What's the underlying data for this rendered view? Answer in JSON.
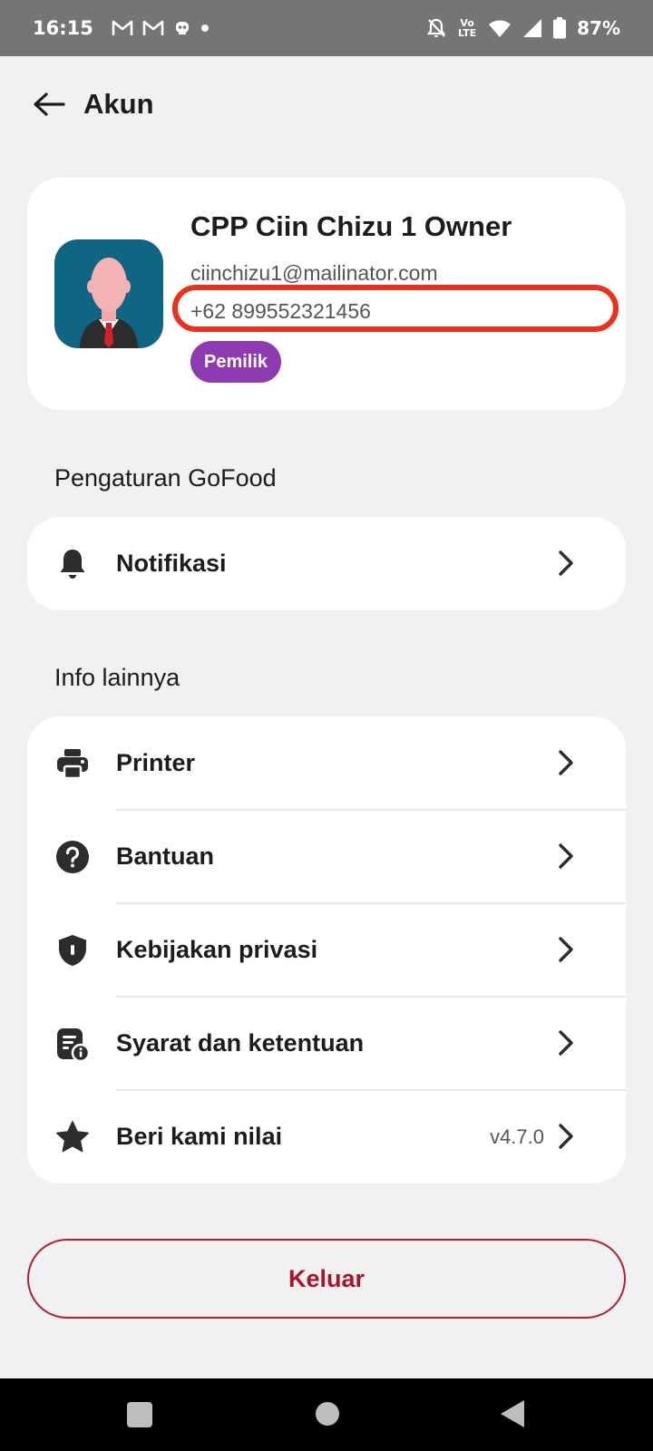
{
  "status_bar": {
    "time": "16:15",
    "battery": "87%",
    "volte": "Vo LTE"
  },
  "header": {
    "title": "Akun"
  },
  "profile": {
    "name": "CPP Ciin Chizu 1 Owner",
    "email": "ciinchizu1@mailinator.com",
    "phone": "+62 899552321456",
    "role": "Pemilik"
  },
  "sections": {
    "gofood_title": "Pengaturan GoFood",
    "other_title": "Info lainnya"
  },
  "gofood_items": [
    {
      "label": "Notifikasi",
      "icon": "bell-icon"
    }
  ],
  "other_items": [
    {
      "label": "Printer",
      "icon": "printer-icon"
    },
    {
      "label": "Bantuan",
      "icon": "help-icon"
    },
    {
      "label": "Kebijakan privasi",
      "icon": "shield-icon"
    },
    {
      "label": "Syarat dan ketentuan",
      "icon": "document-info-icon"
    },
    {
      "label": "Beri kami nilai",
      "icon": "star-icon",
      "version": "v4.7.0"
    }
  ],
  "logout_label": "Keluar",
  "colors": {
    "accent_red": "#a8142b",
    "badge_purple": "#8e3bb3",
    "highlight_red": "#e8321b",
    "avatar_bg": "#0f6682"
  }
}
